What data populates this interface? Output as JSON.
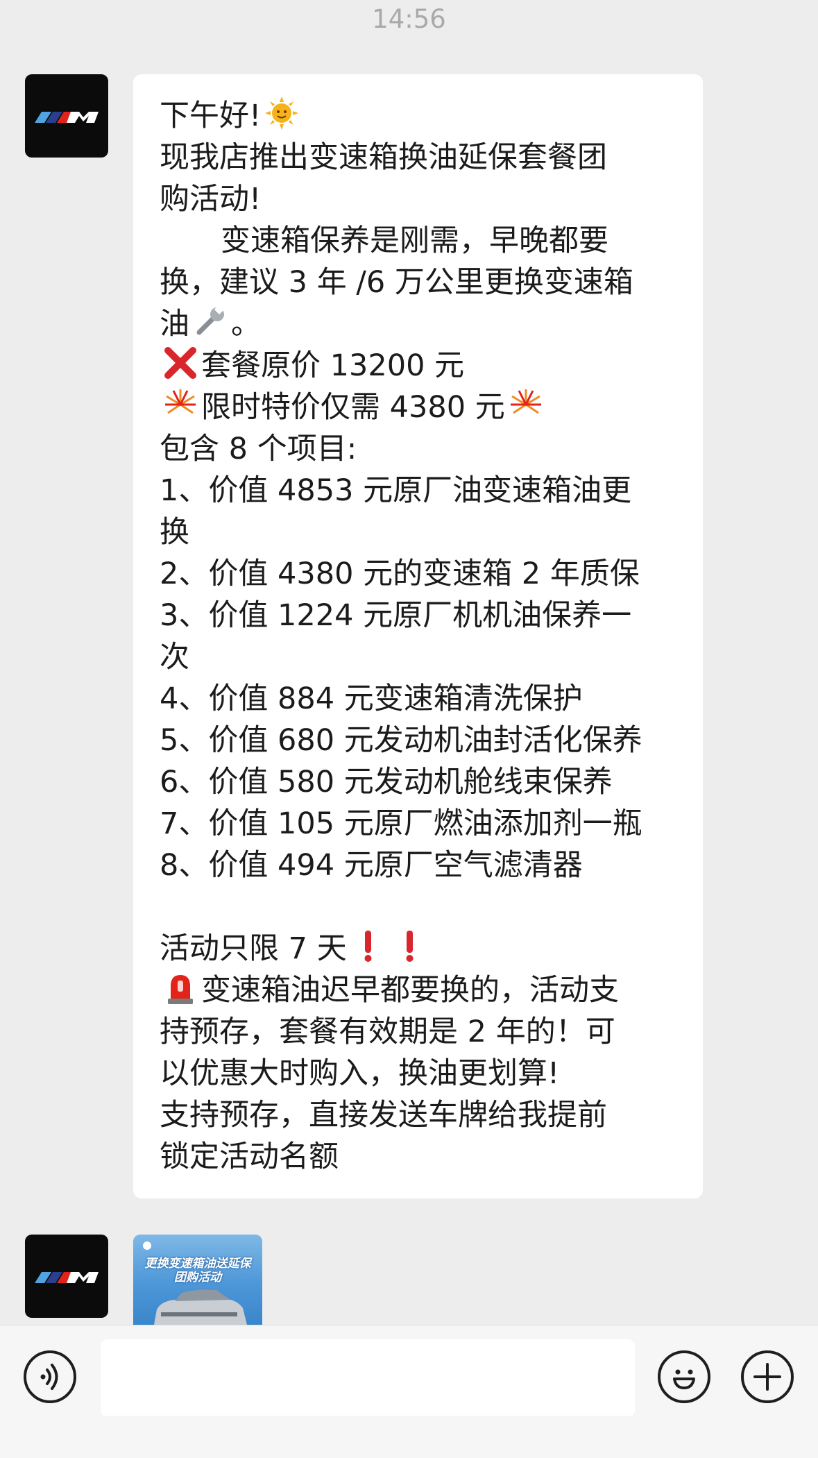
{
  "status": {
    "time": "14:56"
  },
  "message": {
    "lines": [
      "下午好!",
      "现我店推出变速箱换油延保套餐团",
      "购活动!",
      "变速箱保养是刚需，早晚都要",
      "换，建议 3 年 /6 万公里更换变速箱",
      "油",
      "套餐原价 13200 元",
      "限时特价仅需 4380 元",
      "包含 8 个项目:",
      "1、价值 4853 元原厂油变速箱油更",
      "换",
      "2、价值 4380 元的变速箱 2 年质保",
      "3、价值 1224 元原厂机机油保养一",
      "次",
      "4、价值 884 元变速箱清洗保护",
      "5、价值 680 元发动机油封活化保养",
      "6、价值 580 元发动机舱线束保养",
      "7、价值 105 元原厂燃油添加剂一瓶",
      "8、价值 494 元原厂空气滤清器",
      "活动只限 7 天",
      "变速箱油迟早都要换的，活动支",
      "持预存，套餐有效期是 2 年的！可",
      "以优惠大时购入，换油更划算!",
      "支持预存，直接发送车牌给我提前",
      "锁定活动名额"
    ],
    "period": "。"
  },
  "card": {
    "title_line1": "更换变速箱油送延保",
    "title_line2": "团购活动"
  },
  "input": {
    "placeholder": ""
  },
  "icons": {
    "voice": "voice-icon",
    "emoji": "emoji-icon",
    "plus": "plus-icon"
  },
  "colors": {
    "bubble": "#ffffff",
    "background": "#ededed",
    "accent_red": "#d9262c"
  }
}
